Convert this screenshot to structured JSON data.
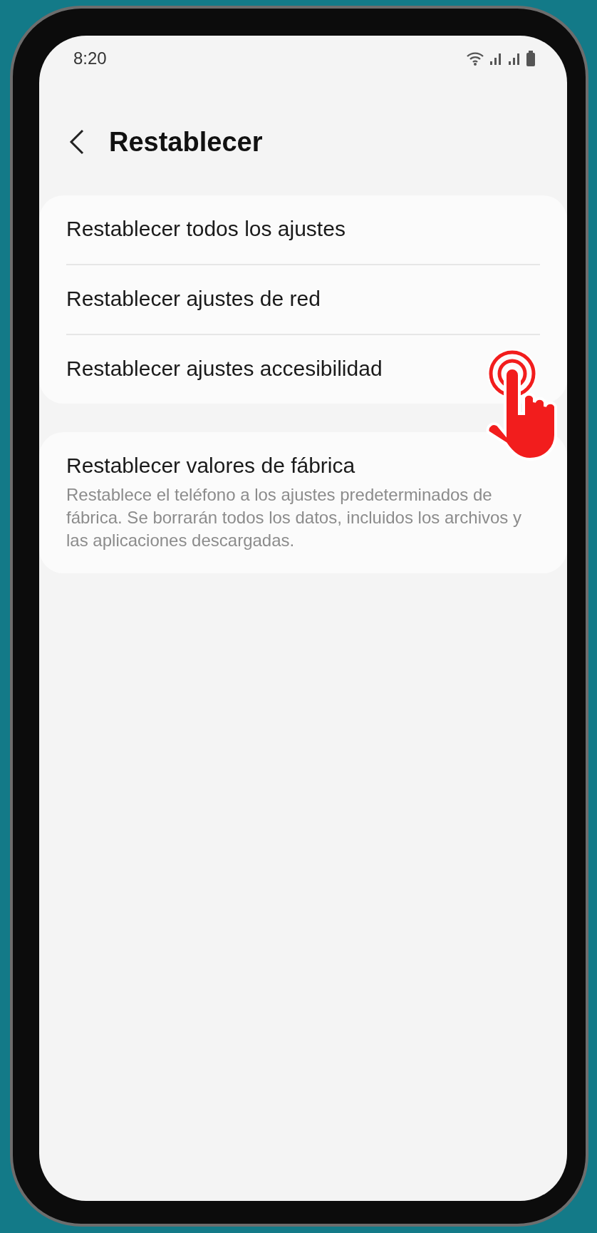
{
  "status_bar": {
    "time": "8:20"
  },
  "header": {
    "title": "Restablecer"
  },
  "groups": [
    {
      "items": [
        {
          "title": "Restablecer todos los ajustes"
        },
        {
          "title": "Restablecer ajustes de red"
        },
        {
          "title": "Restablecer ajustes accesibilidad"
        }
      ]
    },
    {
      "items": [
        {
          "title": "Restablecer valores de fábrica",
          "description": "Restablece el teléfono a los ajustes predeterminados de fábrica. Se borrarán todos los datos, incluidos los archivos y las aplicaciones descargadas."
        }
      ]
    }
  ]
}
